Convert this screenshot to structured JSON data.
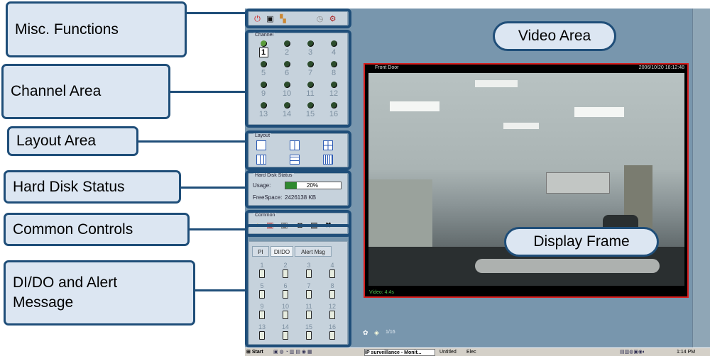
{
  "callouts": {
    "misc": "Misc. Functions",
    "channel": "Channel Area",
    "layout": "Layout Area",
    "hdd": "Hard Disk Status",
    "common": "Common Controls",
    "dido_line1": "DI/DO and Alert",
    "dido_line2": "Message",
    "video": "Video Area",
    "display": "Display Frame"
  },
  "channel_group": {
    "label": "Channel",
    "channels": [
      "1",
      "2",
      "3",
      "4",
      "5",
      "6",
      "7",
      "8",
      "9",
      "10",
      "11",
      "12",
      "13",
      "14",
      "15",
      "16"
    ],
    "selected": "1"
  },
  "layout_group": {
    "label": "Layout"
  },
  "hdd": {
    "label": "Hard Disk Status",
    "usage_label": "Usage:",
    "usage_value": "20%",
    "usage_fraction": 0.2,
    "free_label": "FreeSpace:",
    "free_value": "2426138 KB"
  },
  "common_group": {
    "label": "Common"
  },
  "dido": {
    "tabs": [
      "PI",
      "DI/DO",
      "Alert Msg"
    ],
    "selected_tab": "DI/DO",
    "items": [
      "1",
      "2",
      "3",
      "4",
      "5",
      "6",
      "7",
      "8",
      "9",
      "10",
      "11",
      "12",
      "13",
      "14",
      "15",
      "16"
    ]
  },
  "video": {
    "camera_name": "Front Door",
    "timestamp": "2006/10/20 18:12:48",
    "status": "Video: 4:4s",
    "page": "1/16"
  },
  "taskbar": {
    "start": "Start",
    "app_task": "IP surveillance - Monit...",
    "task2": "Untitled",
    "task3": "Elec",
    "clock": "1:14 PM"
  },
  "colors": {
    "accent_border": "#1f4e79",
    "callout_fill": "#dce6f2",
    "frame_border": "#d81e1e",
    "app_bg": "#7896ad"
  }
}
